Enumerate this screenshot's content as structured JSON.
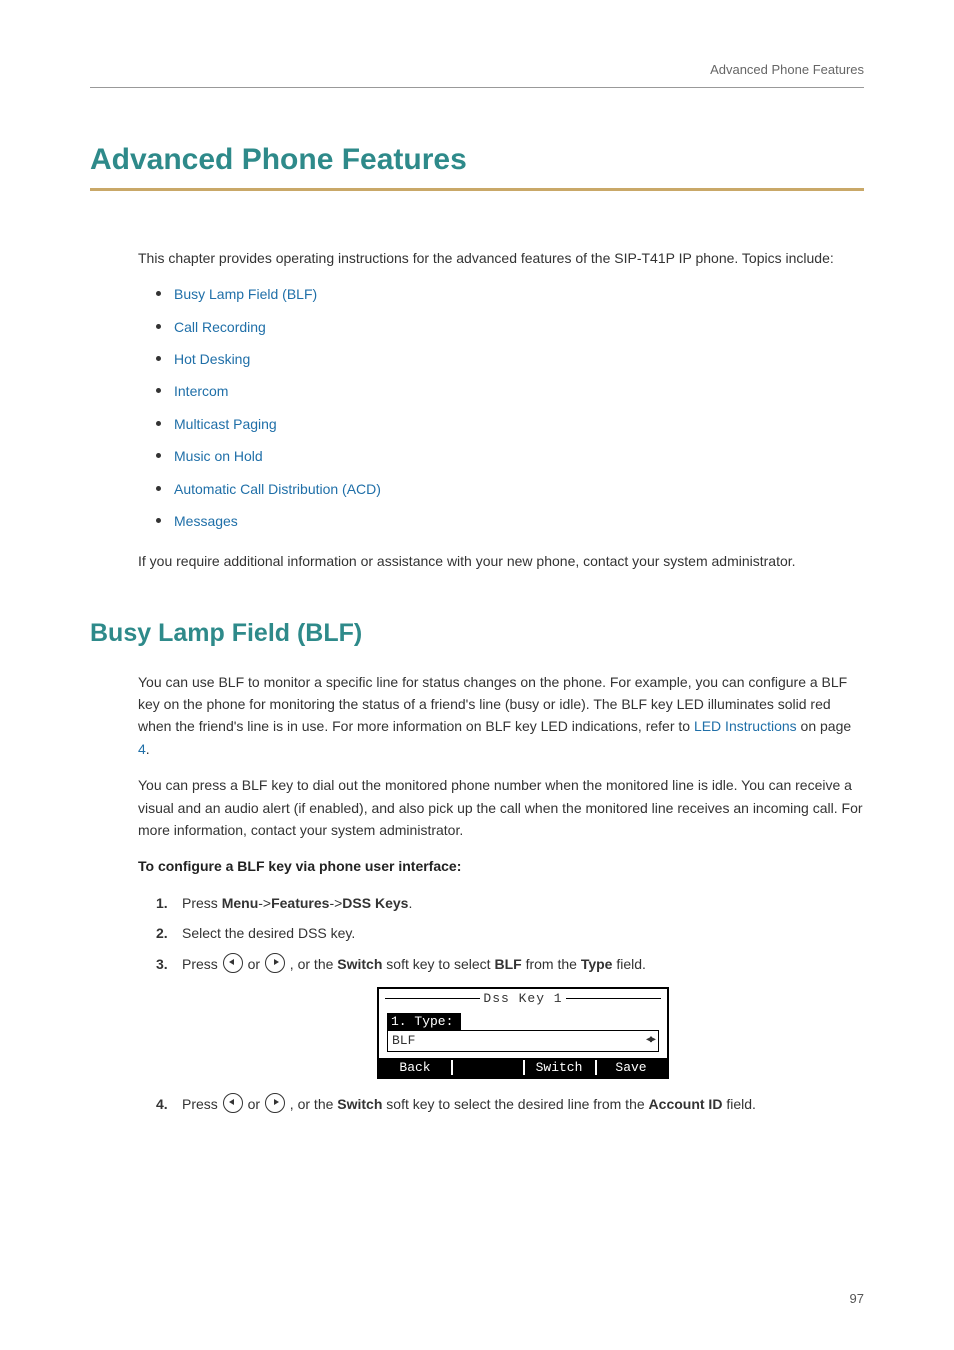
{
  "running_header": "Advanced Phone Features",
  "chapter_title": "Advanced Phone Features",
  "intro": "This chapter provides operating instructions for the advanced features of the SIP-T41P IP phone. Topics include:",
  "toc": [
    "Busy Lamp Field (BLF)",
    "Call Recording",
    "Hot Desking",
    "Intercom",
    "Multicast Paging",
    "Music on Hold",
    "Automatic Call Distribution (ACD)",
    "Messages"
  ],
  "post_toc": "If you require additional information or assistance with your new phone, contact your system administrator.",
  "section": {
    "title": "Busy Lamp Field (BLF)",
    "para1_a": "You can use BLF to monitor a specific line for status changes on the phone. For example, you can configure a BLF key on the phone for monitoring the status of a friend's line (busy or idle). The BLF key LED illuminates solid red when the friend's line is in use. For more information on BLF key LED indications, refer to ",
    "para1_link": "LED Instructions",
    "para1_b": " on page ",
    "para1_page": "4",
    "para1_c": ".",
    "para2": "You can press a BLF key to dial out the monitored phone number when the monitored line is idle. You can receive a visual and an audio alert (if enabled), and also pick up the call when the monitored line receives an incoming call. For more information, contact your system administrator.",
    "subhead": "To configure a BLF key via phone user interface:",
    "steps": {
      "s1": {
        "a": "Press ",
        "menu": "Menu",
        "arrow1": "->",
        "features": "Features",
        "arrow2": "->",
        "dss": "DSS Keys",
        "end": "."
      },
      "s2": "Select the desired DSS key.",
      "s3": {
        "a": "Press ",
        "b": " or ",
        "c": " , or the ",
        "switch": "Switch",
        "d": " soft key to select ",
        "blf": "BLF",
        "e": " from the ",
        "type": "Type",
        "f": " field."
      },
      "s4": {
        "a": "Press ",
        "b": " or ",
        "c": " , or the ",
        "switch": "Switch",
        "d": " soft key to select the desired line from the ",
        "acct": "Account ID",
        "e": " field."
      }
    }
  },
  "phone_screen": {
    "title": "Dss Key 1",
    "field_label": "1. Type:",
    "field_value": "BLF",
    "softkeys": [
      "Back",
      "",
      "Switch",
      "Save"
    ]
  },
  "page_number": "97"
}
